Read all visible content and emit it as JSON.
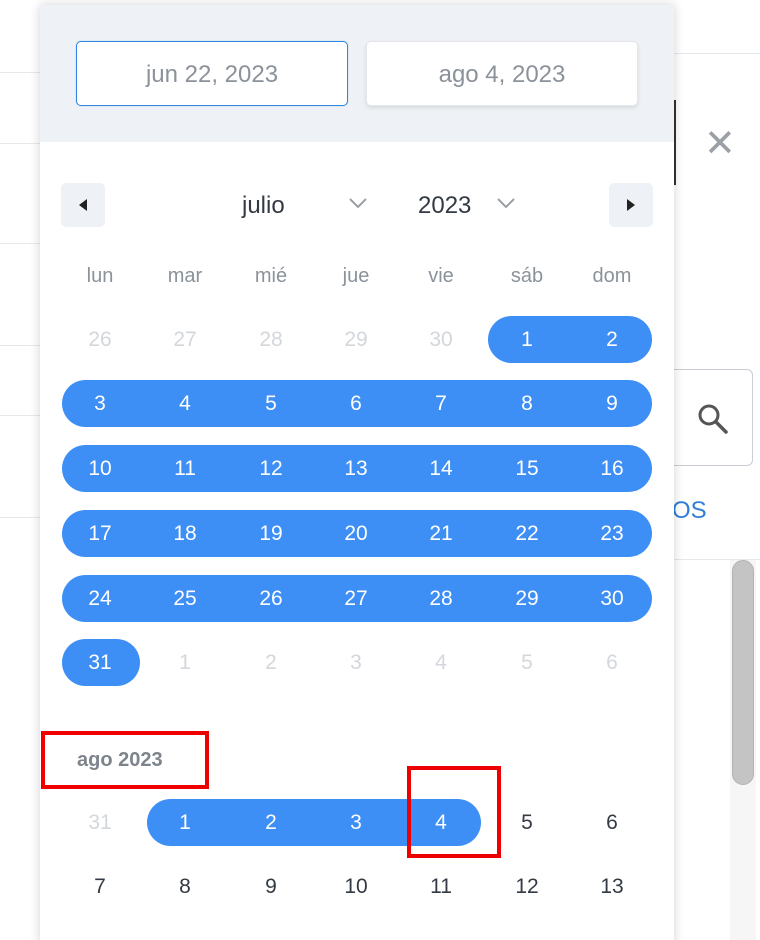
{
  "range": {
    "start": "jun 22, 2023",
    "end": "ago 4, 2023"
  },
  "nav": {
    "prev_icon": "triangle-left-icon",
    "next_icon": "triangle-right-icon"
  },
  "month_select": {
    "value": "julio",
    "icon": "chevron-down-icon"
  },
  "year_select": {
    "value": "2023",
    "icon": "chevron-down-icon"
  },
  "weekdays": [
    "lun",
    "mar",
    "mié",
    "jue",
    "vie",
    "sáb",
    "dom"
  ],
  "july": {
    "weeks": [
      [
        "26",
        "27",
        "28",
        "29",
        "30",
        "1",
        "2"
      ],
      [
        "3",
        "4",
        "5",
        "6",
        "7",
        "8",
        "9"
      ],
      [
        "10",
        "11",
        "12",
        "13",
        "14",
        "15",
        "16"
      ],
      [
        "17",
        "18",
        "19",
        "20",
        "21",
        "22",
        "23"
      ],
      [
        "24",
        "25",
        "26",
        "27",
        "28",
        "29",
        "30"
      ],
      [
        "31",
        "1",
        "2",
        "3",
        "4",
        "5",
        "6"
      ]
    ]
  },
  "august": {
    "label": "ago 2023",
    "weeks": [
      [
        "31",
        "1",
        "2",
        "3",
        "4",
        "5",
        "6"
      ],
      [
        "7",
        "8",
        "9",
        "10",
        "11",
        "12",
        "13"
      ]
    ]
  },
  "background": {
    "link_text": "OS"
  },
  "colors": {
    "accent": "#3d8ff5",
    "highlight": "#ee0000",
    "header_bg": "#eef1f5"
  }
}
